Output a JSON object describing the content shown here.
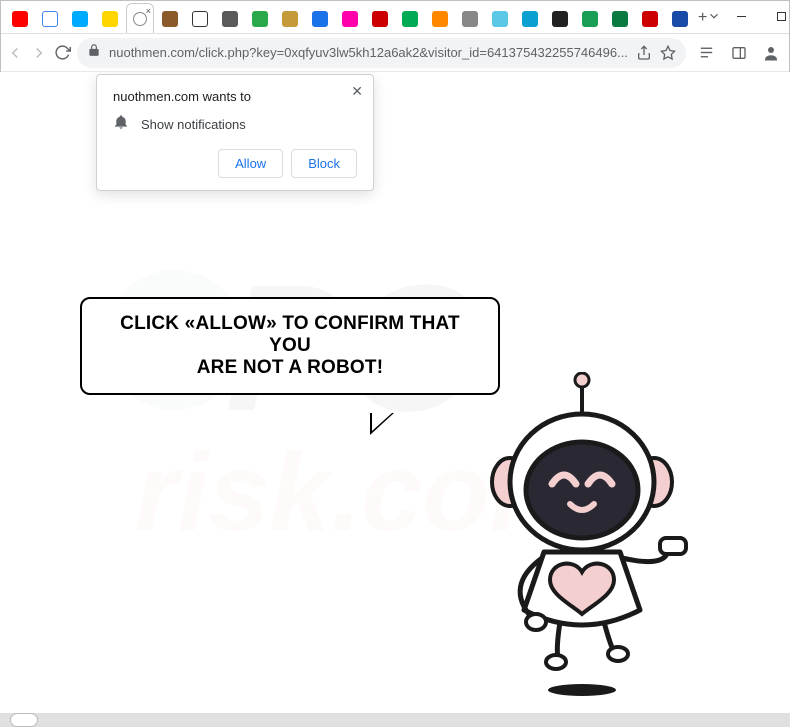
{
  "window": {
    "tabs_favicons": [
      {
        "bg": "#ff0000"
      },
      {
        "bg": "#ffffff",
        "border": "#4285f4"
      },
      {
        "bg": "#00aaff"
      },
      {
        "bg": "#ffd600"
      },
      {
        "bg": "#ffffff",
        "border": "#ccc",
        "active": true
      },
      {
        "bg": "#8a5a2a"
      },
      {
        "bg": "#ffffff",
        "border": "#333"
      },
      {
        "bg": "#5a5a5a"
      },
      {
        "bg": "#2aa84a"
      },
      {
        "bg": "#c59a3a"
      },
      {
        "bg": "#1a73e8"
      },
      {
        "bg": "#ff00aa"
      },
      {
        "bg": "#cc0000"
      },
      {
        "bg": "#00aa55"
      },
      {
        "bg": "#ff8800"
      },
      {
        "bg": "#888888"
      },
      {
        "bg": "#5cc8e8"
      },
      {
        "bg": "#0aa0d0"
      },
      {
        "bg": "#222222"
      },
      {
        "bg": "#1a9e55"
      },
      {
        "bg": "#0a7a40"
      },
      {
        "bg": "#cc0000"
      },
      {
        "bg": "#1a4aa8"
      }
    ],
    "dropdown_glyph": "⌄"
  },
  "addressbar": {
    "url_display": "nuothmen.com/click.php?key=0xqfyuv3lw5kh12a6ak2&visitor_id=641375432255746496..."
  },
  "notification": {
    "title": "nuothmen.com wants to",
    "permission": "Show notifications",
    "allow": "Allow",
    "block": "Block"
  },
  "page": {
    "bubble_line1": "CLICK «ALLOW» TO CONFIRM THAT YOU",
    "bubble_line2": "ARE NOT A ROBOT!"
  },
  "watermark": {
    "line1": "PC",
    "line2": "risk.com"
  }
}
